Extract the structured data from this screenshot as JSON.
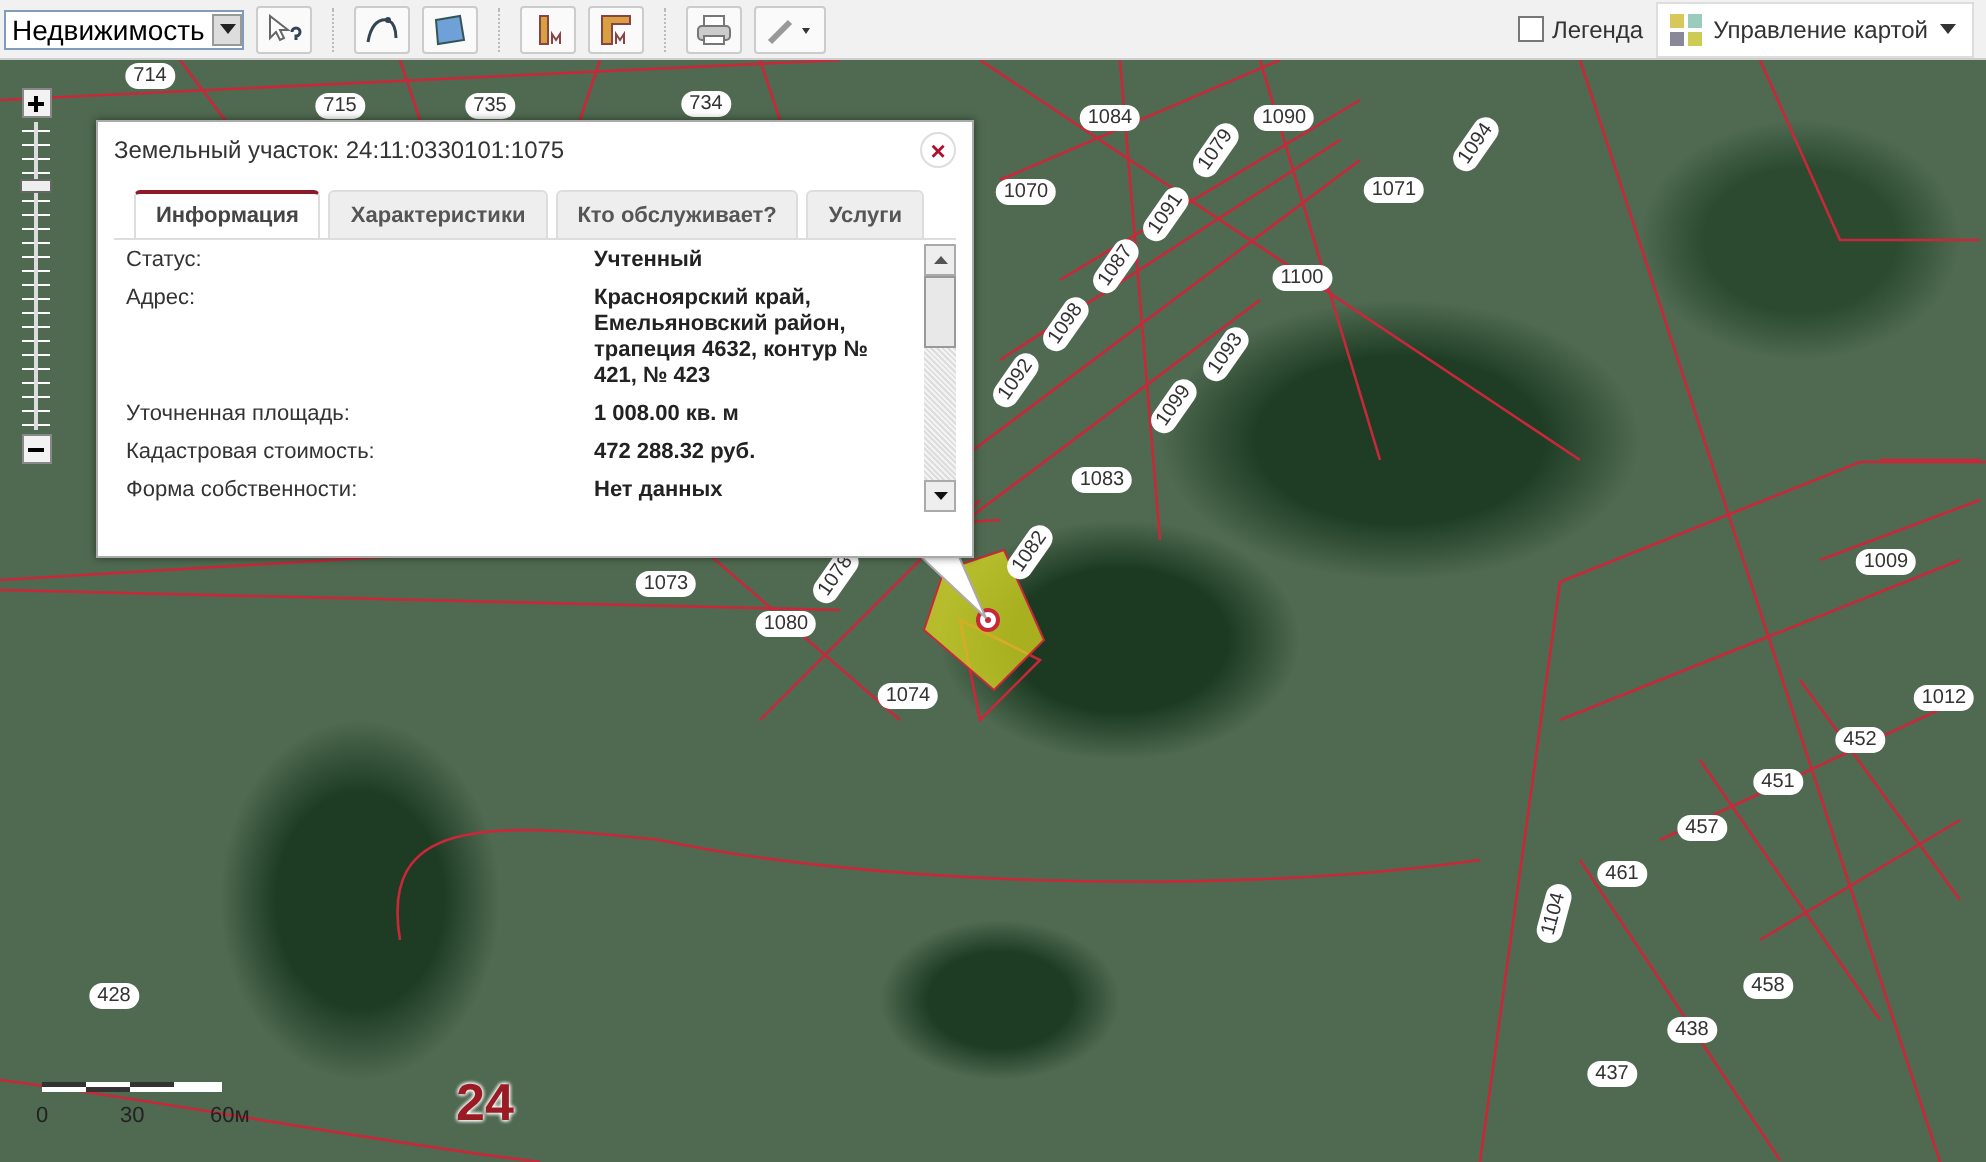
{
  "toolbar": {
    "layer_select": {
      "value": "Недвижимость"
    },
    "legend": {
      "label": "Легенда",
      "checked": false
    },
    "map_control": {
      "label": "Управление картой"
    }
  },
  "zoom": {
    "level": 0.79
  },
  "popup": {
    "title": "Земельный участок: 24:11:0330101:1075",
    "close": "×",
    "tabs": [
      {
        "label": "Информация",
        "selected": true
      },
      {
        "label": "Характеристики",
        "selected": false
      },
      {
        "label": "Кто обслуживает?",
        "selected": false
      },
      {
        "label": "Услуги",
        "selected": false
      }
    ],
    "rows": [
      {
        "label": "Статус:",
        "value": "Учтенный"
      },
      {
        "label": "Адрес:",
        "value": "Красноярский край, Емельяновский район, трапеция 4632, контур № 421, № 423"
      },
      {
        "label": "Уточненная площадь:",
        "value": "1 008.00 кв. м"
      },
      {
        "label": "Кадастровая стоимость:",
        "value": "472 288.32 руб."
      },
      {
        "label": "Форма собственности:",
        "value": "Нет данных"
      }
    ]
  },
  "parcels": [
    "714",
    "715",
    "735",
    "734",
    "1084",
    "1090",
    "1079",
    "1094",
    "1070",
    "1091",
    "1071",
    "1087",
    "1100",
    "1098",
    "1093",
    "1092",
    "1099",
    "1083",
    "1073",
    "1078",
    "1082",
    "1080",
    "1074",
    "1009",
    "1012",
    "452",
    "451",
    "457",
    "461",
    "1104",
    "458",
    "438",
    "437",
    "428"
  ],
  "scale": {
    "labels": [
      "0",
      "30",
      "60м"
    ]
  },
  "region_number": "24"
}
